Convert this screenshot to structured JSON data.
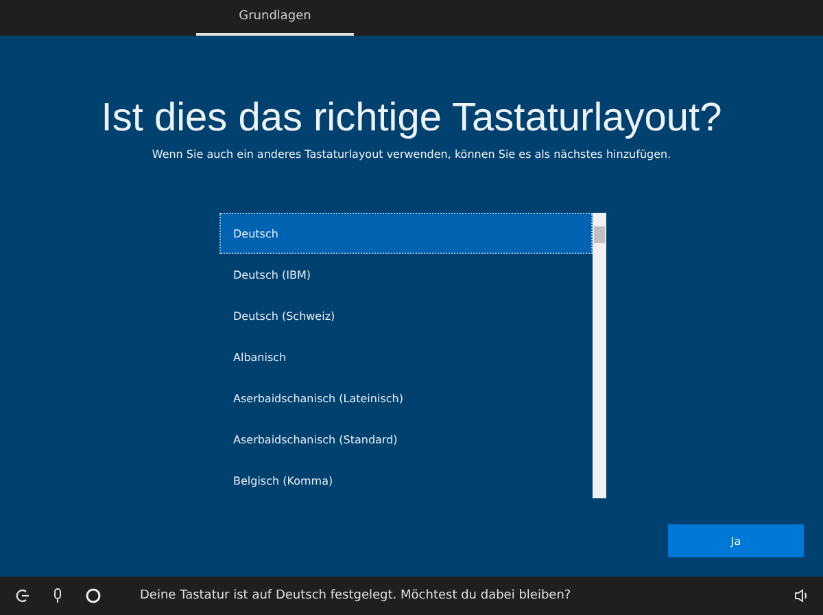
{
  "tabs": [
    {
      "label": "Grundlagen",
      "selected": true
    }
  ],
  "title": "Ist dies das richtige Tastaturlayout?",
  "subtitle": "Wenn Sie auch ein anderes Tastaturlayout verwenden, können Sie es als nächstes hinzufügen.",
  "layouts": [
    {
      "label": "Deutsch",
      "selected": true
    },
    {
      "label": "Deutsch (IBM)",
      "selected": false
    },
    {
      "label": "Deutsch (Schweiz)",
      "selected": false
    },
    {
      "label": "Albanisch",
      "selected": false
    },
    {
      "label": "Aserbaidschanisch (Lateinisch)",
      "selected": false
    },
    {
      "label": "Aserbaidschanisch (Standard)",
      "selected": false
    },
    {
      "label": "Belgisch (Komma)",
      "selected": false
    }
  ],
  "button": "Ja",
  "status_bar": {
    "message": "Deine Tastatur ist auf Deutsch festgelegt. Möchtest du dabei bleiben?"
  }
}
